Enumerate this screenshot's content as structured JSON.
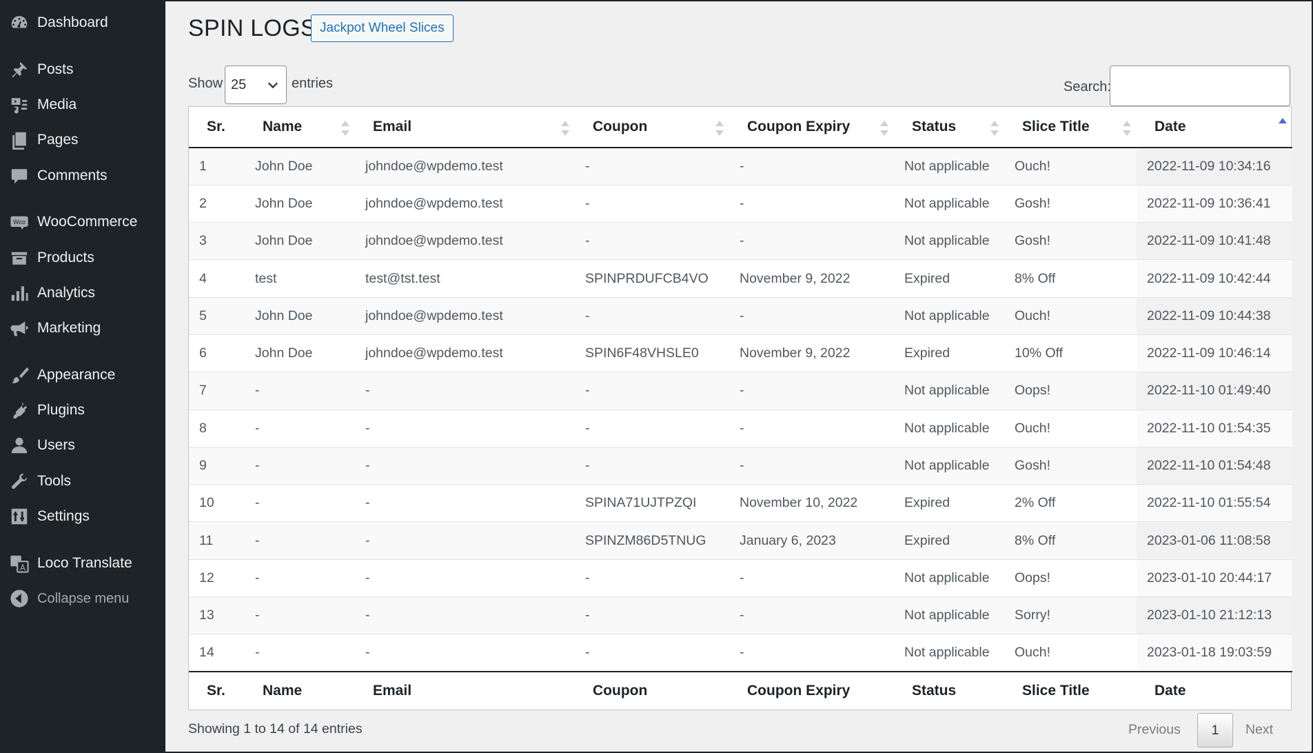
{
  "sidebar": {
    "items": [
      {
        "label": "Dashboard",
        "icon": "dashboard-icon"
      },
      {
        "label": "Posts",
        "icon": "pin-icon"
      },
      {
        "label": "Media",
        "icon": "media-icon"
      },
      {
        "label": "Pages",
        "icon": "pages-icon"
      },
      {
        "label": "Comments",
        "icon": "comment-icon"
      },
      {
        "label": "WooCommerce",
        "icon": "woo-icon"
      },
      {
        "label": "Products",
        "icon": "archive-icon"
      },
      {
        "label": "Analytics",
        "icon": "bar-chart-icon"
      },
      {
        "label": "Marketing",
        "icon": "megaphone-icon"
      },
      {
        "label": "Appearance",
        "icon": "brush-icon"
      },
      {
        "label": "Plugins",
        "icon": "plug-icon"
      },
      {
        "label": "Users",
        "icon": "user-icon"
      },
      {
        "label": "Tools",
        "icon": "wrench-icon"
      },
      {
        "label": "Settings",
        "icon": "sliders-icon"
      },
      {
        "label": "Loco Translate",
        "icon": "translate-icon"
      },
      {
        "label": "Collapse menu",
        "icon": "collapse-icon"
      }
    ]
  },
  "page": {
    "title": "SPIN LOGS",
    "title_button": "Jackpot Wheel Slices"
  },
  "length": {
    "show_label": "Show",
    "value": "25",
    "entries_label": "entries"
  },
  "search": {
    "label": "Search:",
    "value": ""
  },
  "table": {
    "columns": [
      "Sr.",
      "Name",
      "Email",
      "Coupon",
      "Coupon Expiry",
      "Status",
      "Slice Title",
      "Date"
    ],
    "rows": [
      [
        "1",
        "John Doe",
        "johndoe@wpdemo.test",
        "-",
        "-",
        "Not applicable",
        "Ouch!",
        "2022-11-09 10:34:16"
      ],
      [
        "2",
        "John Doe",
        "johndoe@wpdemo.test",
        "-",
        "-",
        "Not applicable",
        "Gosh!",
        "2022-11-09 10:36:41"
      ],
      [
        "3",
        "John Doe",
        "johndoe@wpdemo.test",
        "-",
        "-",
        "Not applicable",
        "Gosh!",
        "2022-11-09 10:41:48"
      ],
      [
        "4",
        "test",
        "test@tst.test",
        "SPINPRDUFCB4VO",
        "November 9, 2022",
        "Expired",
        "8% Off",
        "2022-11-09 10:42:44"
      ],
      [
        "5",
        "John Doe",
        "johndoe@wpdemo.test",
        "-",
        "-",
        "Not applicable",
        "Ouch!",
        "2022-11-09 10:44:38"
      ],
      [
        "6",
        "John Doe",
        "johndoe@wpdemo.test",
        "SPIN6F48VHSLE0",
        "November 9, 2022",
        "Expired",
        "10% Off",
        "2022-11-09 10:46:14"
      ],
      [
        "7",
        "-",
        "-",
        "-",
        "-",
        "Not applicable",
        "Oops!",
        "2022-11-10 01:49:40"
      ],
      [
        "8",
        "-",
        "-",
        "-",
        "-",
        "Not applicable",
        "Ouch!",
        "2022-11-10 01:54:35"
      ],
      [
        "9",
        "-",
        "-",
        "-",
        "-",
        "Not applicable",
        "Gosh!",
        "2022-11-10 01:54:48"
      ],
      [
        "10",
        "-",
        "-",
        "SPINA71UJTPZQI",
        "November 10, 2022",
        "Expired",
        "2% Off",
        "2022-11-10 01:55:54"
      ],
      [
        "11",
        "-",
        "-",
        "SPINZM86D5TNUG",
        "January 6, 2023",
        "Expired",
        "8% Off",
        "2023-01-06 11:08:58"
      ],
      [
        "12",
        "-",
        "-",
        "-",
        "-",
        "Not applicable",
        "Oops!",
        "2023-01-10 20:44:17"
      ],
      [
        "13",
        "-",
        "-",
        "-",
        "-",
        "Not applicable",
        "Sorry!",
        "2023-01-10 21:12:13"
      ],
      [
        "14",
        "-",
        "-",
        "-",
        "-",
        "Not applicable",
        "Ouch!",
        "2023-01-18 19:03:59"
      ]
    ]
  },
  "footer": {
    "info": "Showing 1 to 14 of 14 entries",
    "previous": "Previous",
    "page": "1",
    "next": "Next"
  },
  "colors": {
    "sidebar_bg": "#1d2327",
    "accent": "#2271b1",
    "sort_active": "#4e6fc4"
  }
}
